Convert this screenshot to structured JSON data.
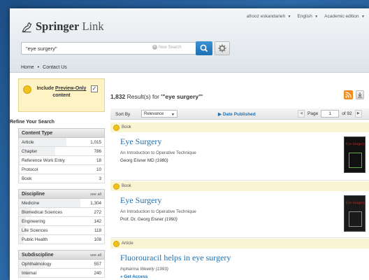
{
  "user_bar": {
    "user": "afrooz eskandarieh",
    "language": "English",
    "edition": "Academic edition"
  },
  "logo": {
    "brand": "Springer",
    "product": "Link"
  },
  "search": {
    "query": "\"eye surgery\"",
    "new_search_label": "New Search"
  },
  "nav": {
    "home": "Home",
    "separator": "•",
    "contact": "Contact Us"
  },
  "sidebar": {
    "preview_label_1": "Include ",
    "preview_label_link": "Preview-Only",
    "preview_label_2": " content",
    "preview_checked": "✓",
    "refine_title": "Refine Your Search",
    "content_type": {
      "title": "Content Type",
      "items": [
        {
          "label": "Article",
          "count": "1,015",
          "share": 0.56
        },
        {
          "label": "Chapter",
          "count": "786",
          "share": 0.43
        },
        {
          "label": "Reference Work Entry",
          "count": "18",
          "share": 0.02
        },
        {
          "label": "Protocol",
          "count": "10",
          "share": 0.01
        },
        {
          "label": "Book",
          "count": "3",
          "share": 0.005
        }
      ]
    },
    "discipline": {
      "title": "Discipline",
      "see_all": "see all",
      "items": [
        {
          "label": "Medicine",
          "count": "1,304",
          "share": 0.72
        },
        {
          "label": "Biomedical Sciences",
          "count": "272",
          "share": 0.15
        },
        {
          "label": "Engineering",
          "count": "142",
          "share": 0.08
        },
        {
          "label": "Life Sciences",
          "count": "118",
          "share": 0.07
        },
        {
          "label": "Public Health",
          "count": "108",
          "share": 0.06
        }
      ]
    },
    "subdiscipline": {
      "title": "Subdiscipline",
      "see_all": "see all",
      "items": [
        {
          "label": "Ophthalmology",
          "count": "557",
          "share": 0.3
        },
        {
          "label": "Internal",
          "count": "240",
          "share": 0.13
        }
      ]
    }
  },
  "main": {
    "results_count": "1,832",
    "results_text": " Result(s) for ",
    "results_query": "'\"eye surgery\"'",
    "sort_by_label": "Sort By",
    "sort_value": "Relevance",
    "date_published": "Date Published",
    "page_label": "Page",
    "page_value": "1",
    "page_total": "of 92",
    "results": [
      {
        "type": "Book",
        "title": "Eye Surgery",
        "subtitle": "An Introduction to Operative Technique",
        "author": "Georg Eisner MD ",
        "year": "(1980)",
        "cover_title": "Eye Surgery"
      },
      {
        "type": "Book",
        "title": "Eye Surgery",
        "subtitle": "An Introduction to Operative Technique",
        "author": "Prof. Dr. Georg Eisner ",
        "year": "(1990)",
        "cover_title": "Eye Surgery"
      },
      {
        "type": "Article",
        "title": "Fluorouracil helps in eye surgery",
        "journal": "Inpharma Weekly (1993)",
        "access": "» Get Access"
      }
    ]
  },
  "colors": {
    "link_blue": "#1d6fb1",
    "highlight_yellow": "#fdf3c4",
    "rss_orange": "#f28c1e"
  }
}
